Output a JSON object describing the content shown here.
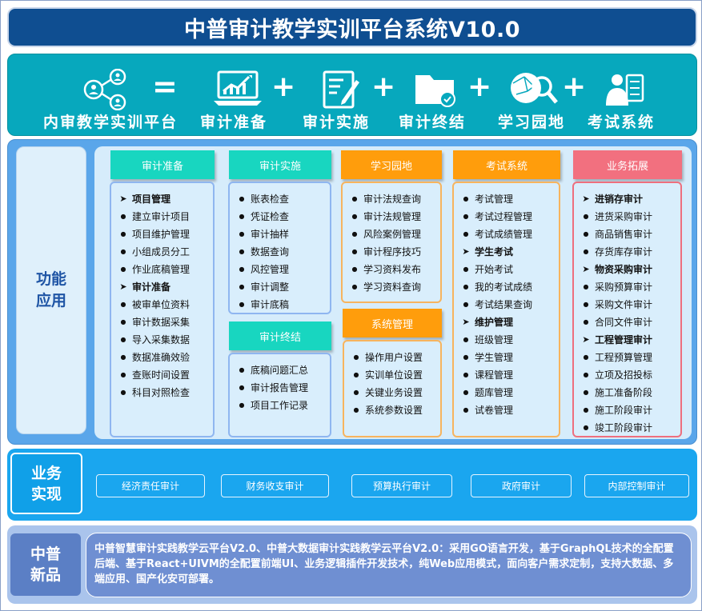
{
  "title": "中普审计教学实训平台系统V10.0",
  "formula": {
    "items": [
      {
        "label": "内审教学实训平台",
        "icon": "network-people-icon"
      },
      {
        "label": "审计准备",
        "icon": "laptop-chart-icon"
      },
      {
        "label": "审计实施",
        "icon": "document-pen-icon"
      },
      {
        "label": "审计终结",
        "icon": "folder-check-icon"
      },
      {
        "label": "学习园地",
        "icon": "globe-magnifier-icon"
      },
      {
        "label": "考试系统",
        "icon": "person-checklist-icon"
      }
    ],
    "equals": "=",
    "plus": "+"
  },
  "function": {
    "label_line1": "功能",
    "label_line2": "应用",
    "columns": {
      "prep": {
        "header": "审计准备",
        "items": [
          {
            "text": "项目管理",
            "bold": true
          },
          {
            "text": "建立审计项目"
          },
          {
            "text": "项目维护管理"
          },
          {
            "text": "小组成员分工"
          },
          {
            "text": "作业底稿管理"
          },
          {
            "text": "审计准备",
            "bold": true
          },
          {
            "text": "被审单位资料"
          },
          {
            "text": "审计数据采集"
          },
          {
            "text": "导入采集数据"
          },
          {
            "text": "数据准确效验"
          },
          {
            "text": "查账时间设置"
          },
          {
            "text": "科目对照检查"
          }
        ]
      },
      "impl": {
        "header": "审计实施",
        "items": [
          {
            "text": "账表检查"
          },
          {
            "text": "凭证检查"
          },
          {
            "text": "审计抽样"
          },
          {
            "text": "数据查询"
          },
          {
            "text": "风控管理"
          },
          {
            "text": "审计调整"
          },
          {
            "text": "审计底稿"
          }
        ]
      },
      "end": {
        "header": "审计终结",
        "items": [
          {
            "text": "底稿问题汇总"
          },
          {
            "text": "审计报告管理"
          },
          {
            "text": "项目工作记录"
          }
        ]
      },
      "learn": {
        "header": "学习园地",
        "items": [
          {
            "text": "审计法规查询"
          },
          {
            "text": "审计法规管理"
          },
          {
            "text": "风险案例管理"
          },
          {
            "text": "审计程序技巧"
          },
          {
            "text": "学习资料发布"
          },
          {
            "text": "学习资料查询"
          }
        ]
      },
      "sys": {
        "header": "系统管理",
        "items": [
          {
            "text": "操作用户设置"
          },
          {
            "text": "实训单位设置"
          },
          {
            "text": "关键业务设置"
          },
          {
            "text": "系统参数设置"
          }
        ]
      },
      "exam": {
        "header": "考试系统",
        "items": [
          {
            "text": "考试管理"
          },
          {
            "text": "考试过程管理"
          },
          {
            "text": "考试成绩管理"
          },
          {
            "text": "学生考试",
            "bold": true
          },
          {
            "text": "开始考试"
          },
          {
            "text": "我的考试成绩"
          },
          {
            "text": "考试结果查询"
          },
          {
            "text": "维护管理",
            "bold": true
          },
          {
            "text": "班级管理"
          },
          {
            "text": "学生管理"
          },
          {
            "text": "课程管理"
          },
          {
            "text": "题库管理"
          },
          {
            "text": "试卷管理"
          }
        ]
      },
      "biz": {
        "header": "业务拓展",
        "items": [
          {
            "text": "进销存审计",
            "bold": true
          },
          {
            "text": "进货采购审计"
          },
          {
            "text": "商品销售审计"
          },
          {
            "text": "存货库存审计"
          },
          {
            "text": "物资采购审计",
            "bold": true
          },
          {
            "text": "采购预算审计"
          },
          {
            "text": "采购文件审计"
          },
          {
            "text": "合同文件审计"
          },
          {
            "text": "工程管理审计",
            "bold": true
          },
          {
            "text": "工程预算管理"
          },
          {
            "text": "立项及招投标"
          },
          {
            "text": "施工准备阶段"
          },
          {
            "text": "施工阶段审计"
          },
          {
            "text": "竣工阶段审计"
          }
        ]
      }
    }
  },
  "business": {
    "label_line1": "业务",
    "label_line2": "实现",
    "buttons": [
      "经济责任审计",
      "财务收支审计",
      "预算执行审计",
      "政府审计",
      "内部控制审计"
    ]
  },
  "product": {
    "label_line1": "中普",
    "label_line2": "新品",
    "text": "中普智慧审计实践教学云平台V2.0、中普大数据审计实践教学云平台V2.0：采用GO语言开发，基于GraphQL技术的全配置后端、基于React+UIVM的全配置前端UI、业务逻辑插件开发技术，纯Web应用模式，面向客户需求定制，支持大数据、多端应用、国产化安可部署。"
  },
  "colors": {
    "title_bg": "#0f4e91",
    "band_bg": "#07a8bd",
    "teal_header": "#18d6c0",
    "orange_header": "#ff9d0c",
    "pink_header": "#f2707f",
    "business_bg": "#1aa6ef",
    "product_bg": "#aac4ec"
  }
}
